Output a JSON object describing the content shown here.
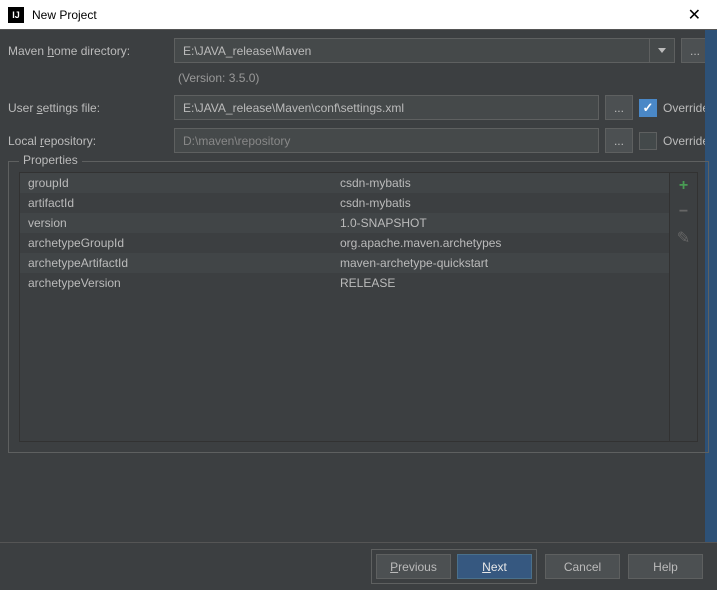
{
  "window": {
    "icon_text": "IJ",
    "title": "New Project",
    "close_glyph": "✕"
  },
  "maven": {
    "home_label_pre": "Maven ",
    "home_label_mn": "h",
    "home_label_post": "ome directory:",
    "home_value": "E:\\JAVA_release\\Maven",
    "version_text": "(Version: 3.5.0)",
    "browse_label": "..."
  },
  "settings": {
    "label_pre": "User ",
    "label_mn": "s",
    "label_post": "ettings file:",
    "value": "E:\\JAVA_release\\Maven\\conf\\settings.xml",
    "override_label": "Override",
    "override_checked": true
  },
  "repo": {
    "label_pre": "Local ",
    "label_mn": "r",
    "label_post": "epository:",
    "value": "D:\\maven\\repository",
    "override_label": "Override",
    "override_checked": false
  },
  "properties": {
    "title": "Properties",
    "rows": [
      {
        "key": "groupId",
        "value": "csdn-mybatis"
      },
      {
        "key": "artifactId",
        "value": "csdn-mybatis"
      },
      {
        "key": "version",
        "value": "1.0-SNAPSHOT"
      },
      {
        "key": "archetypeGroupId",
        "value": "org.apache.maven.archetypes"
      },
      {
        "key": "archetypeArtifactId",
        "value": "maven-archetype-quickstart"
      },
      {
        "key": "archetypeVersion",
        "value": "RELEASE"
      }
    ],
    "icons": {
      "plus": "+",
      "minus": "−",
      "edit": "✎"
    }
  },
  "footer": {
    "previous_mn": "P",
    "previous_post": "revious",
    "next_mn": "N",
    "next_post": "ext",
    "cancel": "Cancel",
    "help": "Help"
  }
}
